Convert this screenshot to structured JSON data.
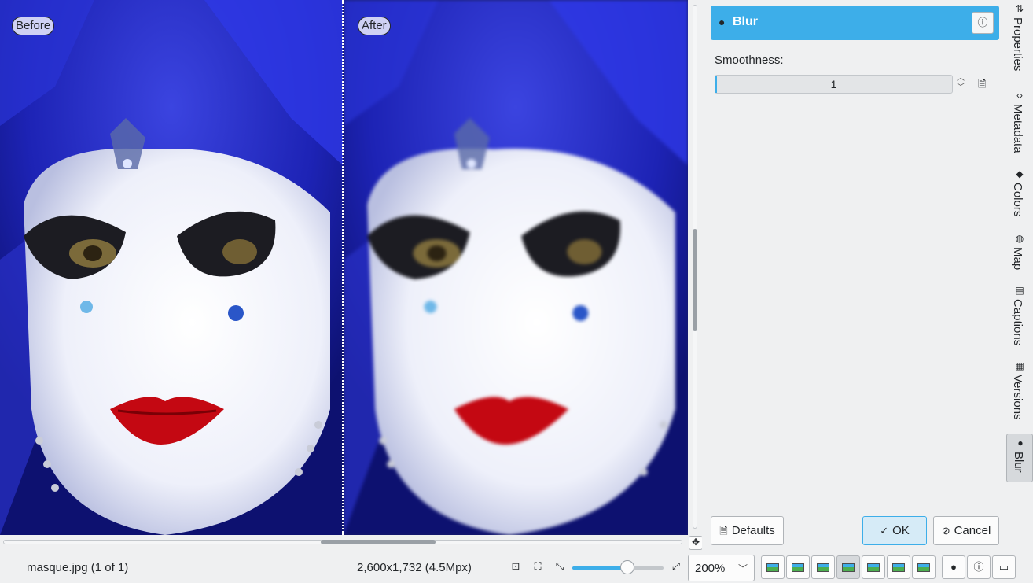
{
  "preview": {
    "before_label": "Before",
    "after_label": "After"
  },
  "tool": {
    "title": "Blur",
    "smoothness_label": "Smoothness:",
    "smoothness_value": "1"
  },
  "buttons": {
    "defaults": "Defaults",
    "ok": "OK",
    "cancel": "Cancel"
  },
  "sidebar_tabs": [
    {
      "label": "Properties",
      "icon": "sliders-icon"
    },
    {
      "label": "Metadata",
      "icon": "code-icon"
    },
    {
      "label": "Colors",
      "icon": "paint-bucket-icon"
    },
    {
      "label": "Map",
      "icon": "globe-icon"
    },
    {
      "label": "Captions",
      "icon": "document-icon"
    },
    {
      "label": "Versions",
      "icon": "versions-icon"
    },
    {
      "label": "Blur",
      "icon": "drop-icon"
    }
  ],
  "status": {
    "file": "masque.jpg (1 of 1)",
    "dimensions": "2,600x1,732 (4.5Mpx)",
    "zoom": "200%",
    "zoom_slider_fraction": 0.6
  },
  "colors": {
    "accent": "#3daee9",
    "background": "#eff0f1"
  }
}
